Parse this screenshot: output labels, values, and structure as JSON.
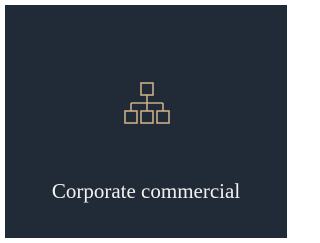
{
  "card": {
    "label": "Corporate commercial",
    "icon": "org-chart-icon",
    "background_color": "#212b38",
    "icon_color": "#c9ad86",
    "text_color": "#f2f2f0"
  }
}
